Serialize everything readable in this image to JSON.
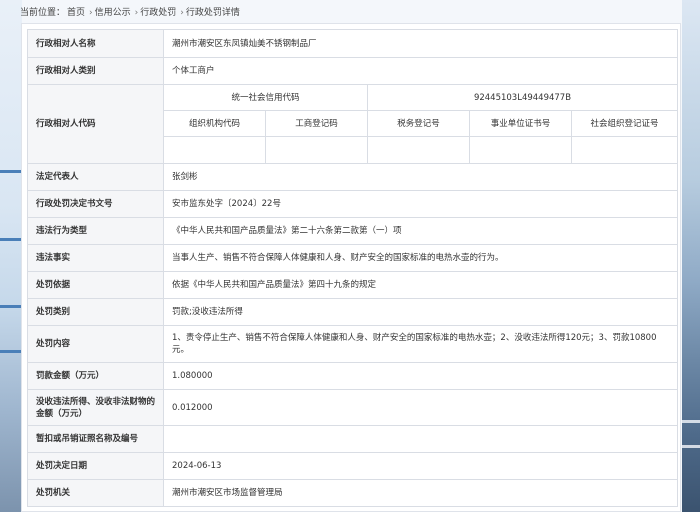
{
  "breadcrumb": {
    "prefix": "当前位置：",
    "items": [
      "首页",
      "信用公示",
      "行政处罚",
      "行政处罚详情"
    ],
    "separator": "›"
  },
  "fields": {
    "party_name": {
      "label": "行政相对人名称",
      "value": "潮州市潮安区东凤镇灿美不锈钢制品厂"
    },
    "party_type": {
      "label": "行政相对人类别",
      "value": "个体工商户"
    },
    "party_code": {
      "label": "行政相对人代码",
      "usc_label": "统一社会信用代码",
      "usc_value": "92445103L49449477B",
      "sub_headers": [
        "组织机构代码",
        "工商登记码",
        "税务登记号",
        "事业单位证书号",
        "社会组织登记证号"
      ],
      "sub_values": [
        "",
        "",
        "",
        "",
        ""
      ]
    },
    "legal_rep": {
      "label": "法定代表人",
      "value": "张剑彬"
    },
    "decision_no": {
      "label": "行政处罚决定书文号",
      "value": "安市监东处字〔2024〕22号"
    },
    "violation_type": {
      "label": "违法行为类型",
      "value": "《中华人民共和国产品质量法》第二十六条第二款第（一）项"
    },
    "violation_facts": {
      "label": "违法事实",
      "value": "当事人生产、销售不符合保障人体健康和人身、财产安全的国家标准的电热水壶的行为。"
    },
    "basis": {
      "label": "处罚依据",
      "value": "依据《中华人民共和国产品质量法》第四十九条的规定"
    },
    "category": {
      "label": "处罚类别",
      "value": "罚款;没收违法所得"
    },
    "content": {
      "label": "处罚内容",
      "value": "1、责令停止生产、销售不符合保障人体健康和人身、财产安全的国家标准的电热水壶；2、没收违法所得120元；3、罚款10800元。"
    },
    "fine_amount": {
      "label": "罚款金额（万元）",
      "value": "1.080000"
    },
    "confiscated": {
      "label": "没收违法所得、没收非法财物的金额（万元）",
      "value": "0.012000"
    },
    "license_revoke": {
      "label": "暂扣或吊销证照名称及编号",
      "value": ""
    },
    "decision_date": {
      "label": "处罚决定日期",
      "value": "2024-06-13"
    },
    "authority": {
      "label": "处罚机关",
      "value": "潮州市潮安区市场监督管理局"
    }
  }
}
